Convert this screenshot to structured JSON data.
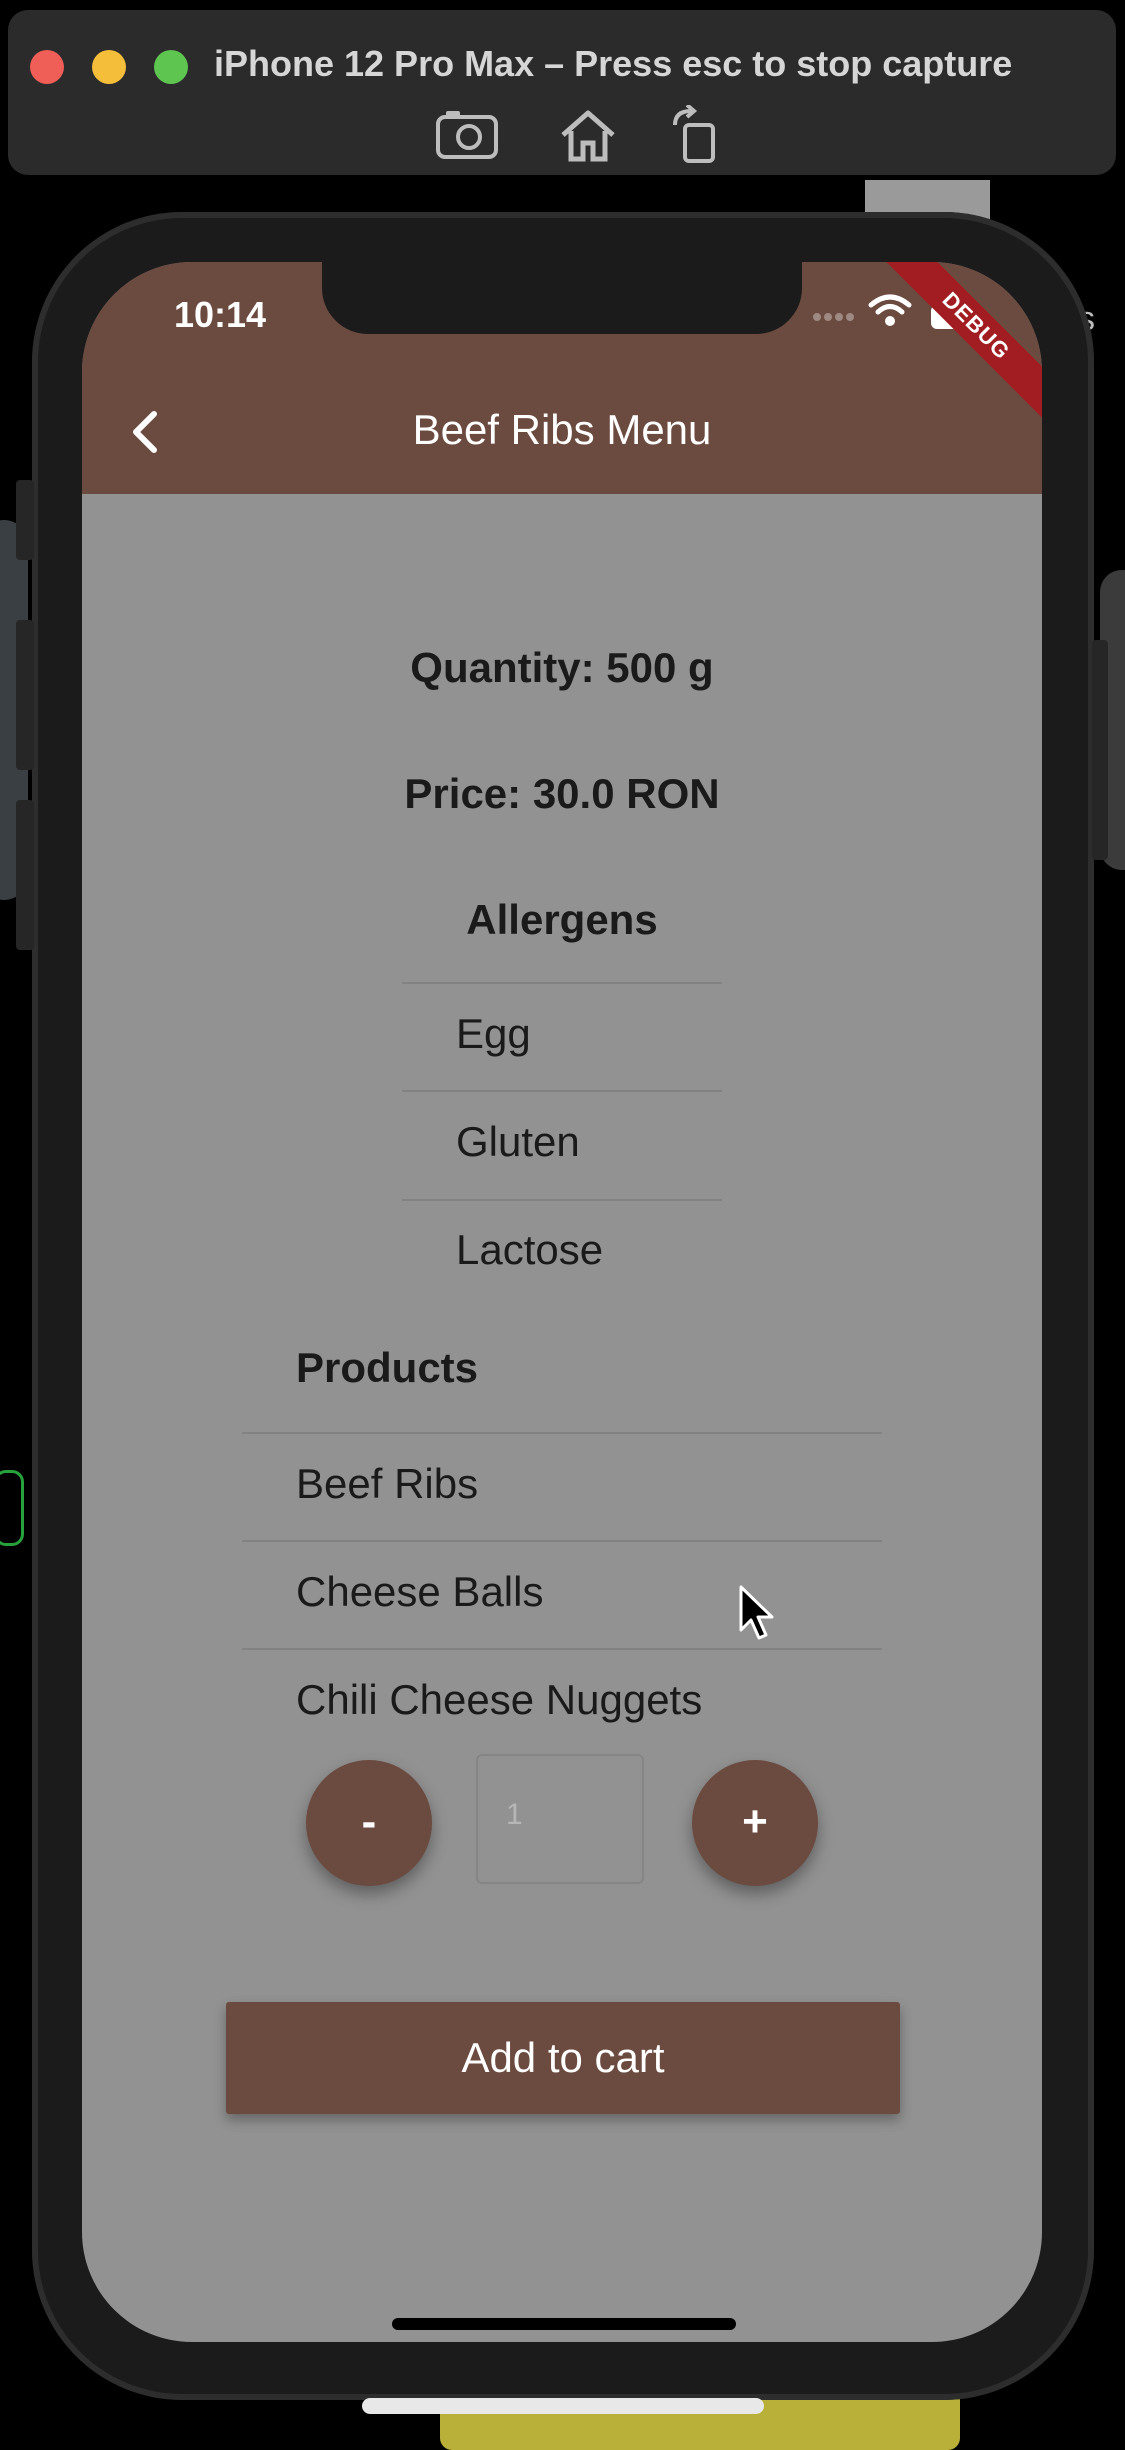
{
  "capture_bar": {
    "title": "iPhone 12 Pro Max – Press esc to stop capture",
    "icons": [
      "screenshot-icon",
      "home-icon",
      "rotate-icon"
    ]
  },
  "status_bar": {
    "time": "10:14",
    "debug_label": "DEBUG"
  },
  "header": {
    "title": "Beef Ribs Menu",
    "back_icon": "chevron-left-icon"
  },
  "details": {
    "quantity": "Quantity: 500 g",
    "price": "Price: 30.0 RON"
  },
  "allergens": {
    "heading": "Allergens",
    "items": [
      "Egg",
      "Gluten",
      "Lactose"
    ]
  },
  "products": {
    "heading": "Products",
    "items": [
      "Beef Ribs",
      "Cheese Balls",
      "Chili Cheese Nuggets"
    ]
  },
  "stepper": {
    "minus_label": "-",
    "plus_label": "+",
    "placeholder": "1"
  },
  "actions": {
    "add_to_cart": "Add to cart"
  },
  "background": {
    "partial_text": "s"
  },
  "colors": {
    "brand_brown": "#6b4a3f",
    "screen_bg": "#929292",
    "debug_red": "#a11d22"
  }
}
